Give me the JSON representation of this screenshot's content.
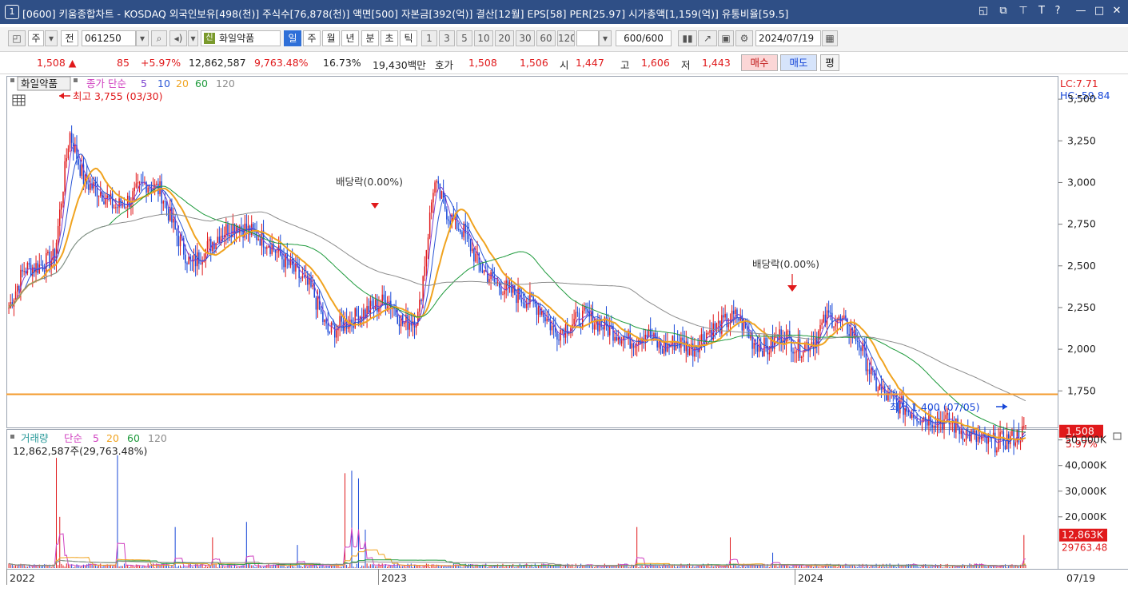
{
  "titlebar": {
    "badge": "1",
    "title": "[0600] 키움종합차트 - KOSDAQ 외국인보유[498(천)] 주식수[76,878(천)] 액면[500] 자본금[392(억)] 결산[12월] EPS[58] PER[25.97] 시가총액[1,159(억)] 유통비율[59.5]",
    "controls": [
      "◱",
      "⧉",
      "⊤",
      "T",
      "?",
      "—",
      "□",
      "✕"
    ]
  },
  "toolbar": {
    "market": "주",
    "all": "전",
    "code": "061250",
    "name_tag": "신",
    "name": "화일약품",
    "periods": [
      "일",
      "주",
      "월",
      "년",
      "분",
      "초",
      "틱"
    ],
    "selected_period": "일",
    "intervals": [
      "1",
      "3",
      "5",
      "10",
      "20",
      "30",
      "60",
      "120"
    ],
    "count": "600/600",
    "date": "2024/07/19"
  },
  "quote": {
    "price": "1,508 ▲",
    "change": "85",
    "change_pct": "+5.97%",
    "volume": "12,862,587",
    "volume_ratio": "9,763.48%",
    "turnover": "16.73%",
    "amount": "19,430백만",
    "hoga_label": "호가",
    "ask": "1,508",
    "bid": "1,506",
    "open_label": "시",
    "open": "1,447",
    "high_label": "고",
    "high": "1,606",
    "low_label": "저",
    "low": "1,443",
    "buy": "매수",
    "sell": "매도",
    "avg": "평"
  },
  "colors": {
    "ma5": "#7a3fd0",
    "ma10": "#2a56d6",
    "ma20": "#f0a31f",
    "ma60": "#1e9a3c",
    "ma120": "#8c8c8c",
    "up": "#e0191b",
    "down": "#1747d8",
    "hline": "#f39a2b"
  },
  "price_panel": {
    "name": "화일약품",
    "ma_label": "종가 단순",
    "ma_periods": [
      "5",
      "10",
      "20",
      "60",
      "120"
    ],
    "lc": "LC:7.71",
    "hc": "HC:-59.84",
    "high_mark": "최고 3,755 (03/30)",
    "low_mark": "최저 1,400 (07/05)",
    "dividend_1": "배당락(0.00%)",
    "dividend_2": "배당락(0.00%)",
    "current_price": "1,508",
    "current_pct": "5.97%",
    "y_ticks": [
      "3,500",
      "3,250",
      "3,000",
      "2,750",
      "2,500",
      "2,250",
      "2,000",
      "1,750"
    ]
  },
  "volume_panel": {
    "label": "거래량",
    "ma_label": "단순",
    "ma_periods": [
      "5",
      "20",
      "60",
      "120"
    ],
    "value_text": "12,862,587주(29,763.48%)",
    "y_ticks": [
      "50,000K",
      "40,000K",
      "30,000K",
      "20,000K"
    ],
    "current": "12,863K",
    "current_pct": "29763.48"
  },
  "x_axis": {
    "labels": [
      "2022",
      "2023",
      "2024"
    ],
    "end_label": "07/19"
  },
  "chart_data": {
    "type": "candlestick",
    "x": [
      "2022",
      "2023",
      "2024",
      "07/19"
    ],
    "price_ticks": [
      3500,
      3250,
      3000,
      2750,
      2500,
      2250,
      2000,
      1750
    ],
    "ylim": [
      1550,
      3630
    ],
    "horizontal_line": 1730,
    "close_path": [
      2250,
      2480,
      2500,
      2550,
      3300,
      3000,
      2950,
      2850,
      2900,
      3000,
      2950,
      2700,
      2500,
      2600,
      2700,
      2750,
      2700,
      2650,
      2550,
      2450,
      2350,
      2100,
      2150,
      2200,
      2250,
      2300,
      2150,
      2200,
      3000,
      2800,
      2700,
      2500,
      2400,
      2350,
      2300,
      2250,
      2100,
      2150,
      2200,
      2150,
      2100,
      2050,
      2100,
      2000,
      2050,
      2000,
      2100,
      2150,
      2200,
      2050,
      2000,
      2100,
      2000,
      2050,
      2200,
      2150,
      2050,
      1800,
      1700,
      1650,
      1600,
      1580,
      1560,
      1500,
      1450,
      1440,
      1460,
      1508
    ],
    "volume_ticks_k": [
      50000,
      40000,
      30000,
      20000
    ],
    "volume_ylim_k": [
      0,
      53000
    ],
    "volume_spikes_k": [
      43000,
      20000,
      44000,
      16000,
      12000,
      18000,
      9000,
      37000,
      38000,
      35000,
      15000,
      16000,
      12000,
      6000,
      12863
    ]
  }
}
